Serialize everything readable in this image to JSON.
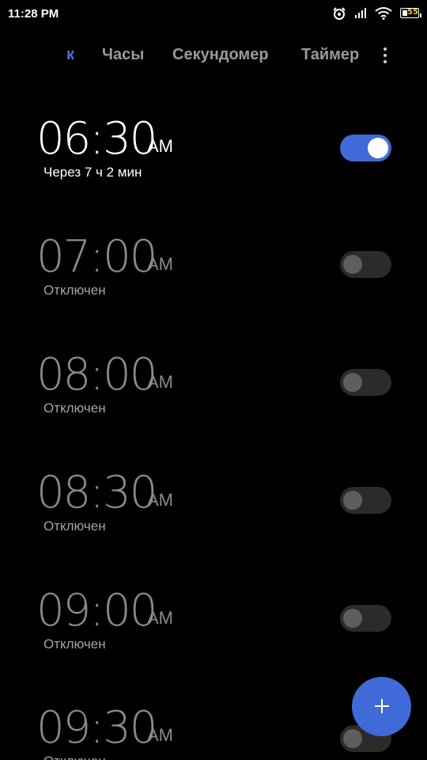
{
  "status_bar": {
    "time": "11:28 PM",
    "battery_level": "55",
    "icons": [
      "alarm-icon",
      "signal-icon",
      "wifi-icon",
      "battery-icon"
    ]
  },
  "tabs": [
    {
      "label": "к",
      "active": true
    },
    {
      "label": "Часы",
      "active": false
    },
    {
      "label": "Секундомер",
      "active": false
    },
    {
      "label": "Таймер",
      "active": false
    }
  ],
  "alarms": [
    {
      "time": "06:30",
      "ampm": "AM",
      "status": "Через 7 ч 2 мин",
      "enabled": true
    },
    {
      "time": "07:00",
      "ampm": "AM",
      "status": "Отключен",
      "enabled": false
    },
    {
      "time": "08:00",
      "ampm": "AM",
      "status": "Отключен",
      "enabled": false
    },
    {
      "time": "08:30",
      "ampm": "AM",
      "status": "Отключен",
      "enabled": false
    },
    {
      "time": "09:00",
      "ampm": "AM",
      "status": "Отключен",
      "enabled": false
    },
    {
      "time": "09:30",
      "ampm": "AM",
      "status": "Отключен",
      "enabled": false
    }
  ],
  "colors": {
    "background": "#000000",
    "accent": "#3f6ad8",
    "active_tab": "#4a74d6",
    "inactive_text": "#8a8a8a"
  },
  "fab_icon": "plus-icon"
}
